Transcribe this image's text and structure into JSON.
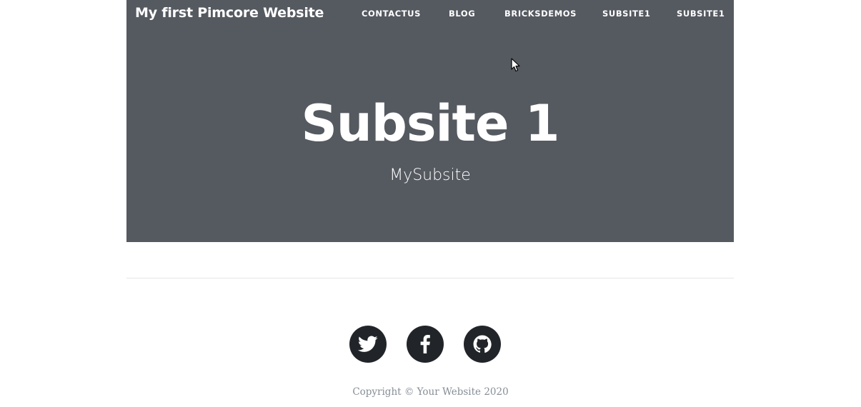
{
  "header": {
    "brand": "My first Pimcore Website",
    "nav": [
      {
        "label": "CONTACTUS"
      },
      {
        "label": "BLOG"
      },
      {
        "label": "BRICKSDEMOS"
      },
      {
        "label": "SUBSITE1"
      },
      {
        "label": "SUBSITE1"
      }
    ]
  },
  "hero": {
    "title": "Subsite 1",
    "subtitle": "MySubsite"
  },
  "footer": {
    "social": [
      {
        "icon": "twitter-icon"
      },
      {
        "icon": "facebook-icon"
      },
      {
        "icon": "github-icon"
      }
    ],
    "copyright": "Copyright © Your Website 2020"
  },
  "colors": {
    "masthead_bg": "#555960",
    "social_bg": "#212529",
    "copyright_text": "#868e96"
  }
}
